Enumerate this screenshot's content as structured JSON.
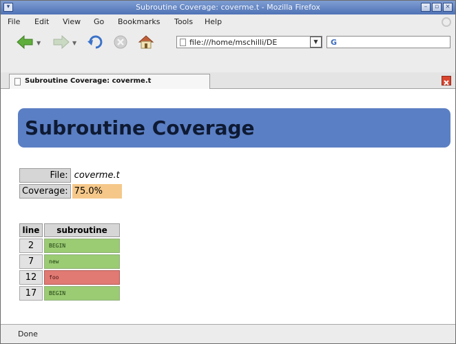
{
  "window": {
    "title": "Subroutine Coverage: coverme.t - Mozilla Firefox",
    "sysmenu_glyph": "▾",
    "controls": {
      "minimize": "–",
      "maximize": "▫",
      "close": "×"
    }
  },
  "menubar": {
    "items": [
      {
        "label": "File",
        "key": "F"
      },
      {
        "label": "Edit",
        "key": "E"
      },
      {
        "label": "View",
        "key": "V"
      },
      {
        "label": "Go",
        "key": "G"
      },
      {
        "label": "Bookmarks",
        "key": "B"
      },
      {
        "label": "Tools",
        "key": "T"
      },
      {
        "label": "Help",
        "key": "H"
      }
    ]
  },
  "navbar": {
    "url": "file:///home/mschilli/DE",
    "search_engine_glyph": "G"
  },
  "tab": {
    "label": "Subroutine Coverage: coverme.t"
  },
  "page": {
    "heading": "Subroutine Coverage",
    "file_label": "File:",
    "file_value": "coverme.t",
    "coverage_label": "Coverage:",
    "coverage_value": "75.0%",
    "subroutine_table": {
      "headers": {
        "line": "line",
        "subroutine": "subroutine"
      },
      "rows": [
        {
          "line": "2",
          "name": "BEGIN",
          "covered": true
        },
        {
          "line": "7",
          "name": "new",
          "covered": true
        },
        {
          "line": "12",
          "name": "foo",
          "covered": false
        },
        {
          "line": "17",
          "name": "BEGIN",
          "covered": true
        }
      ]
    }
  },
  "status": {
    "text": "Done"
  },
  "colors": {
    "heading_bg": "#5b7fc4",
    "covered": "#9bcb73",
    "uncovered": "#e07a73",
    "coverage_highlight": "#f5c88a"
  }
}
